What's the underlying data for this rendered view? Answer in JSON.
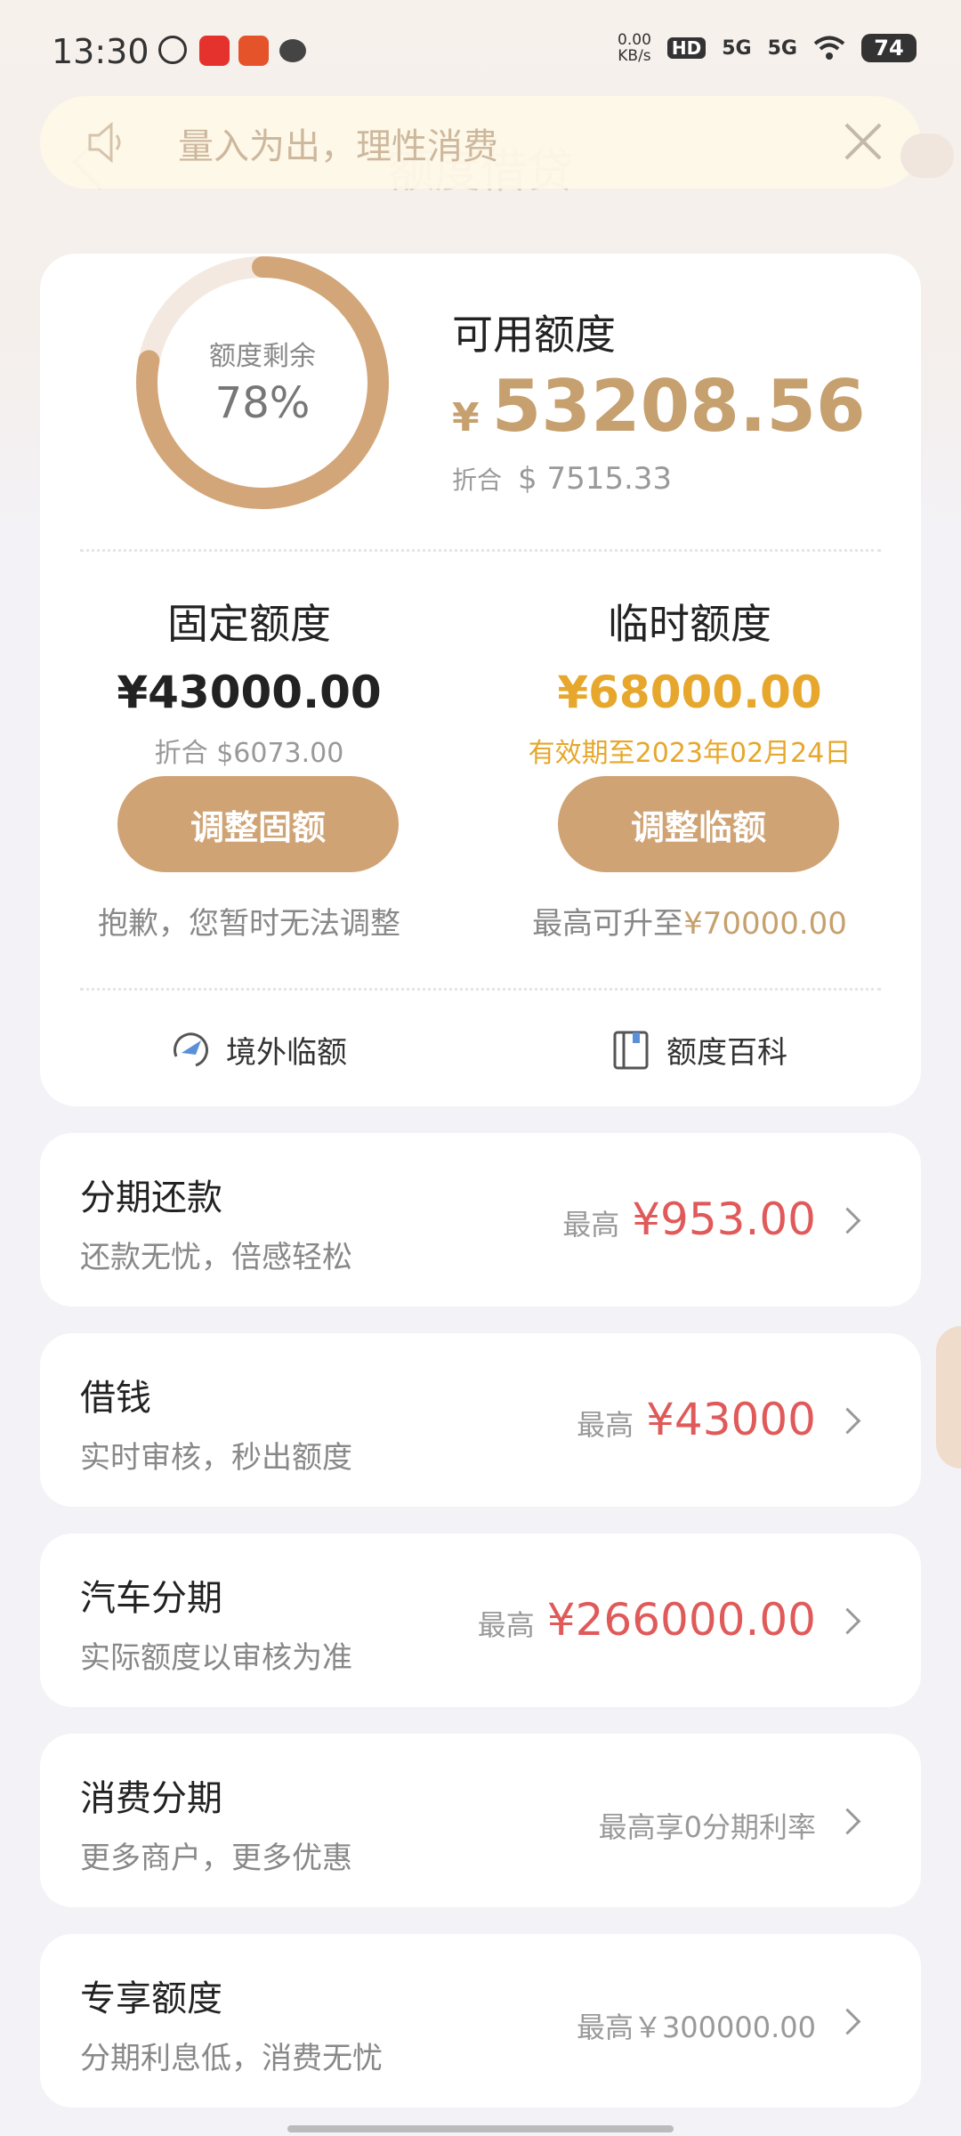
{
  "status_bar": {
    "time": "13:30",
    "net_speed": "0.00",
    "net_unit": "KB/s",
    "hd": "HD",
    "sig1": "5G",
    "sig2": "5G",
    "battery": "74"
  },
  "header": {
    "title": "额度借贷"
  },
  "toast": {
    "text": "量入为出，理性消费"
  },
  "summary": {
    "ring_label": "额度剩余",
    "ring_percent": "78%",
    "ring_fraction": 0.78,
    "available_label": "可用额度",
    "available_currency": "¥",
    "available_amount": "53208.56",
    "available_usd_label": "折合",
    "available_usd": "$ 7515.33"
  },
  "fixed": {
    "title": "固定额度",
    "amount": "¥43000.00",
    "sub": "折合 $6073.00",
    "button": "调整固额",
    "note": "抱歉，您暂时无法调整"
  },
  "temp": {
    "title": "临时额度",
    "amount": "¥68000.00",
    "sub": "有效期至2023年02月24日",
    "button": "调整临额",
    "note_prefix": "最高可升至",
    "note_value": "¥70000.00"
  },
  "links": {
    "overseas": "境外临额",
    "wiki": "额度百科"
  },
  "rows": [
    {
      "title": "分期还款",
      "sub": "还款无忧，倍感轻松",
      "prefix": "最高",
      "value": "¥953.00"
    },
    {
      "title": "借钱",
      "sub": "实时审核，秒出额度",
      "prefix": "最高",
      "value": "¥43000"
    },
    {
      "title": "汽车分期",
      "sub": "实际额度以审核为准",
      "prefix": "最高",
      "value": "¥266000.00"
    },
    {
      "title": "消费分期",
      "sub": "更多商户，更多优惠",
      "text": "最高享0分期利率"
    },
    {
      "title": "专享额度",
      "sub": "分期利息低，消费无忧",
      "text": "最高￥300000.00"
    }
  ],
  "colors": {
    "gold": "#c6a06e",
    "button": "#cfa374",
    "red": "#e05a5a",
    "temp_gold": "#e6a72c"
  }
}
